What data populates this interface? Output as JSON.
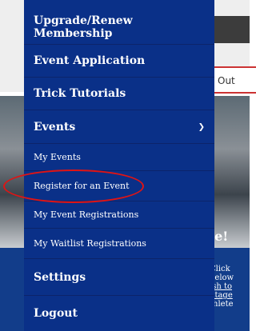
{
  "background": {
    "button_label": "Out",
    "heading": "le!",
    "text_lines": [
      "e",
      "Click",
      "below",
      "ish to",
      "ntage",
      "thlete"
    ]
  },
  "menu": {
    "items": [
      {
        "label": "Upgrade/Renew Membership"
      },
      {
        "label": "Event Application"
      },
      {
        "label": "Trick Tutorials"
      },
      {
        "label": "Events",
        "expanded": true,
        "icon": "chevron-down-icon"
      },
      {
        "label": "My Events"
      },
      {
        "label": "Register for an Event",
        "highlighted": true
      },
      {
        "label": "My Event Registrations"
      },
      {
        "label": "My Waitlist Registrations"
      },
      {
        "label": "Settings"
      },
      {
        "label": "Logout"
      }
    ]
  },
  "colors": {
    "menu_bg": "#0a3088",
    "annotation": "#e01414"
  }
}
